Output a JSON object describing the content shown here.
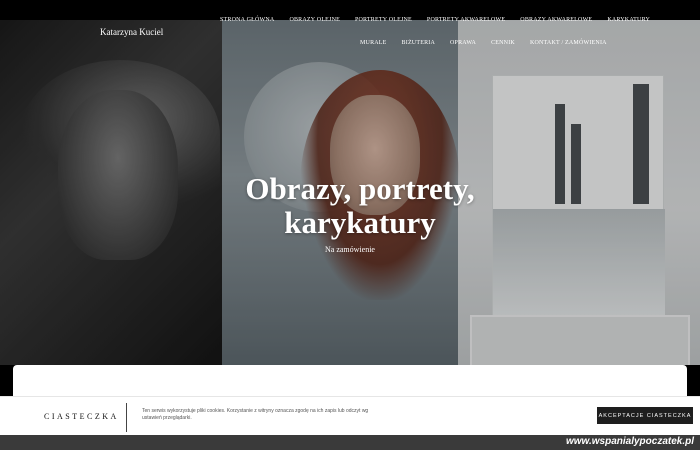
{
  "header": {
    "brand": "Katarzyna Kuciel",
    "nav_row1": [
      "STRONA GŁÓWNA",
      "OBRAZY OLEJNE",
      "PORTRETY OLEJNE",
      "PORTRETY AKWARELOWE",
      "OBRAZY AKWARELOWE",
      "KARYKATURY"
    ],
    "nav_row2": [
      "MURALE",
      "BIŻUTERIA",
      "OPRAWA",
      "CENNIK",
      "KONTAKT / ZAMÓWIENIA"
    ]
  },
  "hero": {
    "title_line1": "Obrazy, portrety,",
    "title_line2": "karykatury",
    "subtitle": "Na zamówienie"
  },
  "cookie_bar": {
    "title": "CIASTECZKA",
    "text": "Ten serwis wykorzystuje pliki cookies. Korzystanie z witryny oznacza zgodę na ich zapis lub odczyt wg ustawień przeglądarki.",
    "accept_label": "AKCEPTACJE CIASTECZKA"
  },
  "footer": {
    "watermark": "www.wspanialypoczatek.pl"
  }
}
